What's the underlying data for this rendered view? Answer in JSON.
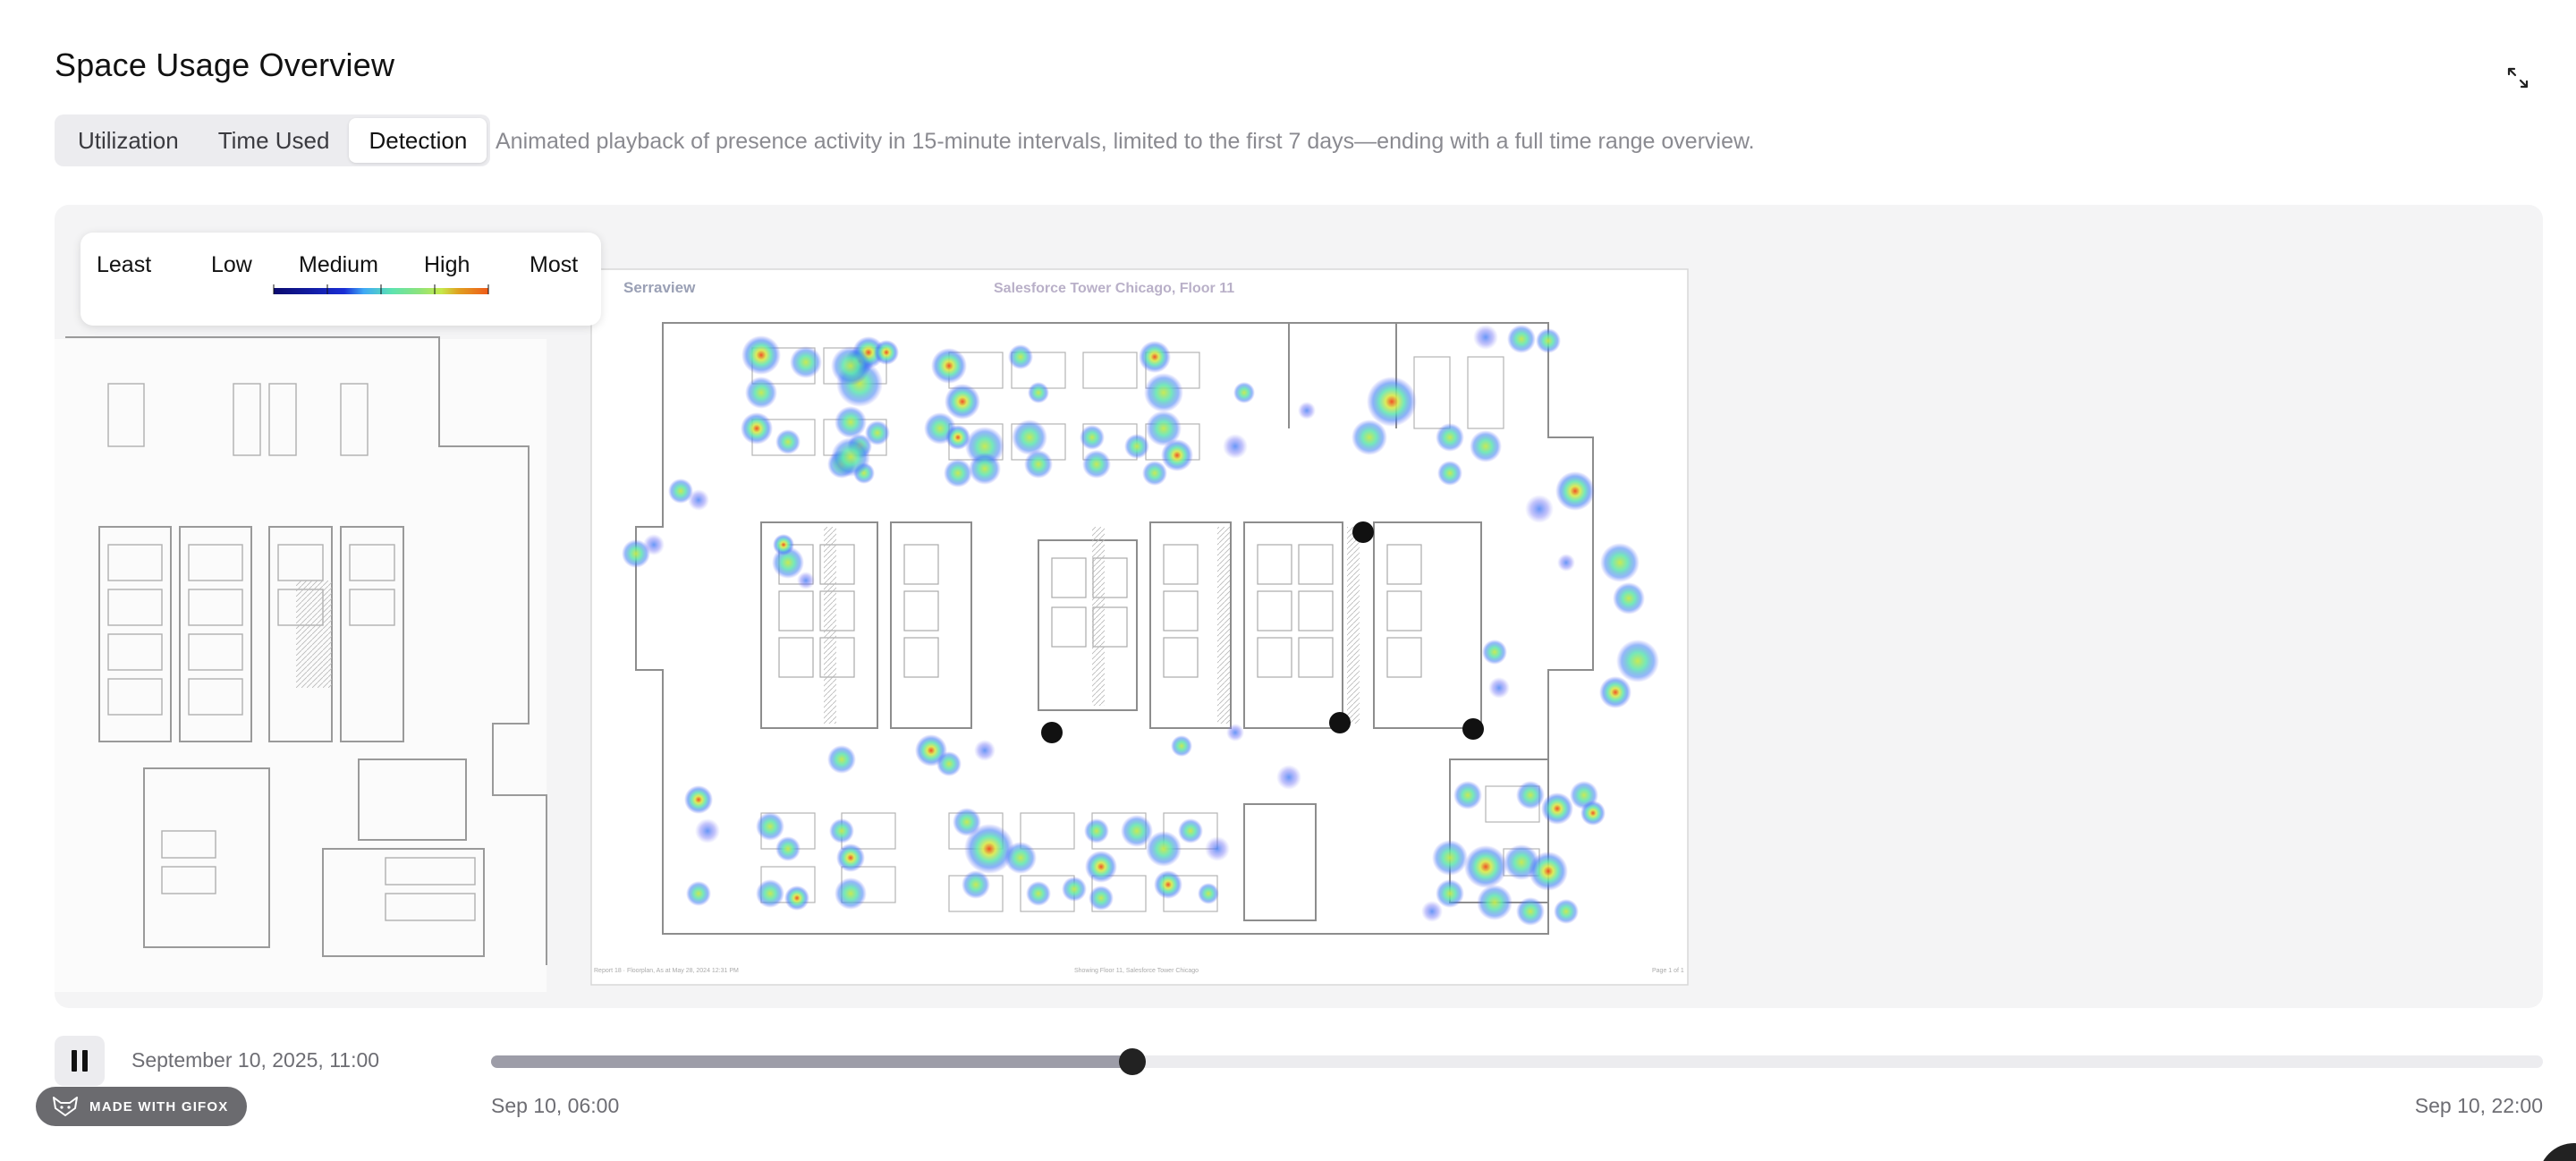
{
  "header": {
    "title": "Space Usage Overview",
    "expand_icon": "expand-arrows-icon"
  },
  "tabs": [
    {
      "label": "Utilization",
      "active": false
    },
    {
      "label": "Time Used",
      "active": false
    },
    {
      "label": "Detection",
      "active": true
    }
  ],
  "tab_description": "Animated playback of presence activity in 15-minute intervals, limited to the first 7 days—ending with a full time range overview.",
  "legend": {
    "labels": [
      "Least",
      "Low",
      "Medium",
      "High",
      "Most"
    ],
    "colors": [
      "#0b0b6e",
      "#1a2ed6",
      "#3fa9f5",
      "#5de3b0",
      "#c6e84a",
      "#f0a020",
      "#f05a1a"
    ]
  },
  "floorplan": {
    "brand": "Serraview",
    "title": "Salesforce Tower Chicago, Floor 11",
    "footer_left": "Report 18 · Floorplan, As at May 28, 2024 12:31 PM",
    "footer_center": "Showing Floor 11, Salesforce Tower Chicago",
    "footer_right": "Page 1 of 1"
  },
  "player": {
    "state": "playing",
    "pause_icon": "pause-icon",
    "current_time": "September 10, 2025, 11:00",
    "start_label": "Sep 10, 06:00",
    "end_label": "Sep 10, 22:00",
    "progress": 0.3125
  },
  "badge": {
    "label": "MADE WITH GIFOX",
    "icon": "fox-icon"
  },
  "colors": {
    "accent": "#222222",
    "track": "#ececef",
    "track_fill": "#9d9da8",
    "panel": "#f4f4f5"
  }
}
